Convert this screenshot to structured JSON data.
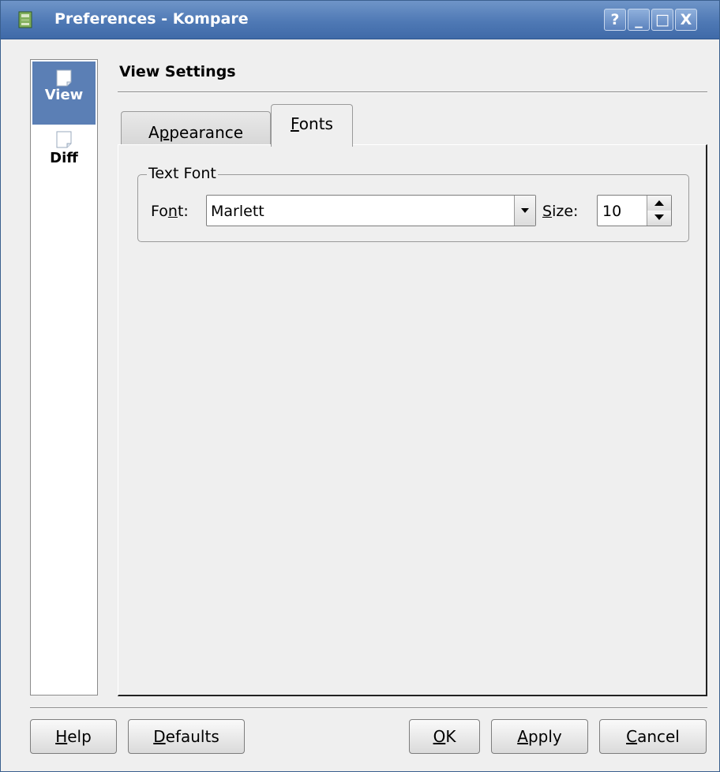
{
  "window": {
    "title": "Preferences - Kompare",
    "controls": {
      "help": "?",
      "minimize": "_",
      "maximize": "□",
      "close": "X"
    }
  },
  "sidebar": {
    "items": [
      {
        "label": "View",
        "icon": "page-icon",
        "active": true
      },
      {
        "label": "Diff",
        "icon": "page-icon",
        "active": false
      }
    ]
  },
  "section": {
    "title": "View Settings"
  },
  "tabs": [
    {
      "pre": "A",
      "mnemonic": "p",
      "post": "pearance",
      "active": false
    },
    {
      "pre": "",
      "mnemonic": "F",
      "post": "onts",
      "active": true
    }
  ],
  "text_font": {
    "group_title": "Text Font",
    "font_label": {
      "pre": "Fo",
      "mnemonic": "n",
      "post": "t:"
    },
    "font_value": "Marlett",
    "size_label": {
      "pre": "",
      "mnemonic": "S",
      "post": "ize:"
    },
    "size_value": "10"
  },
  "buttons": {
    "help": {
      "pre": "",
      "mnemonic": "H",
      "post": "elp"
    },
    "defaults": {
      "pre": "",
      "mnemonic": "D",
      "post": "efaults"
    },
    "ok": {
      "pre": "",
      "mnemonic": "O",
      "post": "K"
    },
    "apply": {
      "pre": "",
      "mnemonic": "A",
      "post": "pply"
    },
    "cancel": {
      "pre": "",
      "mnemonic": "C",
      "post": "ancel"
    }
  },
  "colors": {
    "titlebar": "#4f79b5",
    "selection": "#5b7fb5",
    "background": "#efefef"
  }
}
